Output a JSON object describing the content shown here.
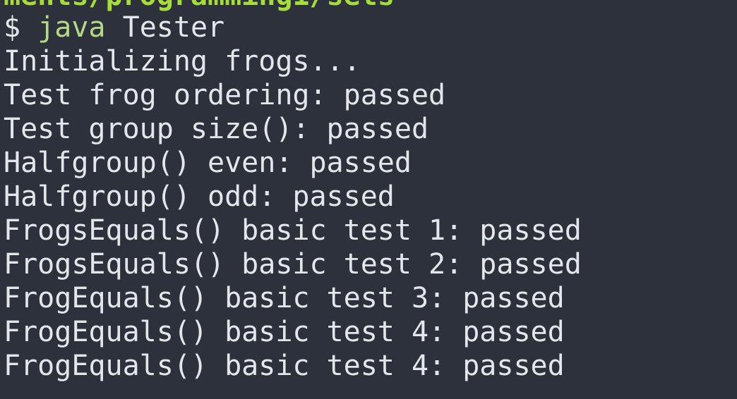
{
  "terminal": {
    "path_fragment": "ments/programming1/sets",
    "prompt": {
      "symbol": "$",
      "command": "java",
      "argument": "Tester"
    },
    "output_lines": [
      "Initializing frogs...",
      "Test frog ordering: passed",
      "Test group size(): passed",
      "Halfgroup() even: passed",
      "Halfgroup() odd: passed",
      "FrogsEquals() basic test 1: passed",
      "FrogsEquals() basic test 2: passed",
      "FrogEquals() basic test 3: passed",
      "FrogEquals() basic test 4: passed",
      "FrogEquals() basic test 4: passed"
    ],
    "colors": {
      "background": "#2d313b",
      "text": "#e3e6ea",
      "path": "#a6dd3b",
      "command": "#b5d886"
    }
  }
}
